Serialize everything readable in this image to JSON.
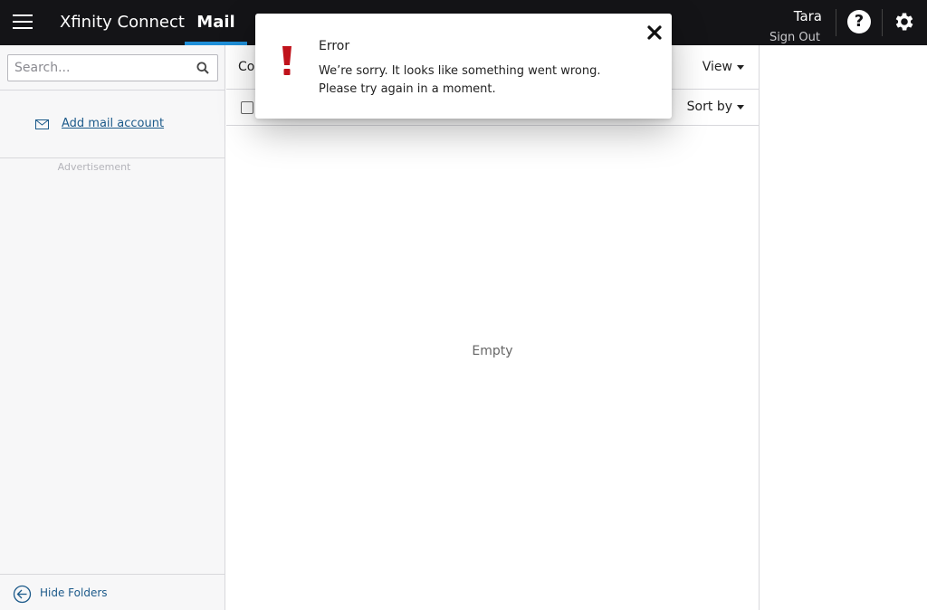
{
  "header": {
    "brand": "Xfinity Connect",
    "active_tab": "Mail",
    "user_name": "Tara",
    "sign_out": "Sign Out"
  },
  "sidebar": {
    "search_placeholder": "Search...",
    "add_mail_account": "Add mail account",
    "advertisement": "Advertisement",
    "hide_folders": "Hide Folders"
  },
  "list": {
    "compose_label": "Co",
    "view_label": "View",
    "sort_label": "Sort by",
    "empty_text": "Empty"
  },
  "dialog": {
    "title": "Error",
    "message_line1": "We’re sorry. It looks like something went wrong.",
    "message_line2": "Please try again in a moment."
  },
  "colors": {
    "topbar": "#141417",
    "accent": "#1f8fd8",
    "error": "#c0121b",
    "link": "#1c5a8a"
  }
}
